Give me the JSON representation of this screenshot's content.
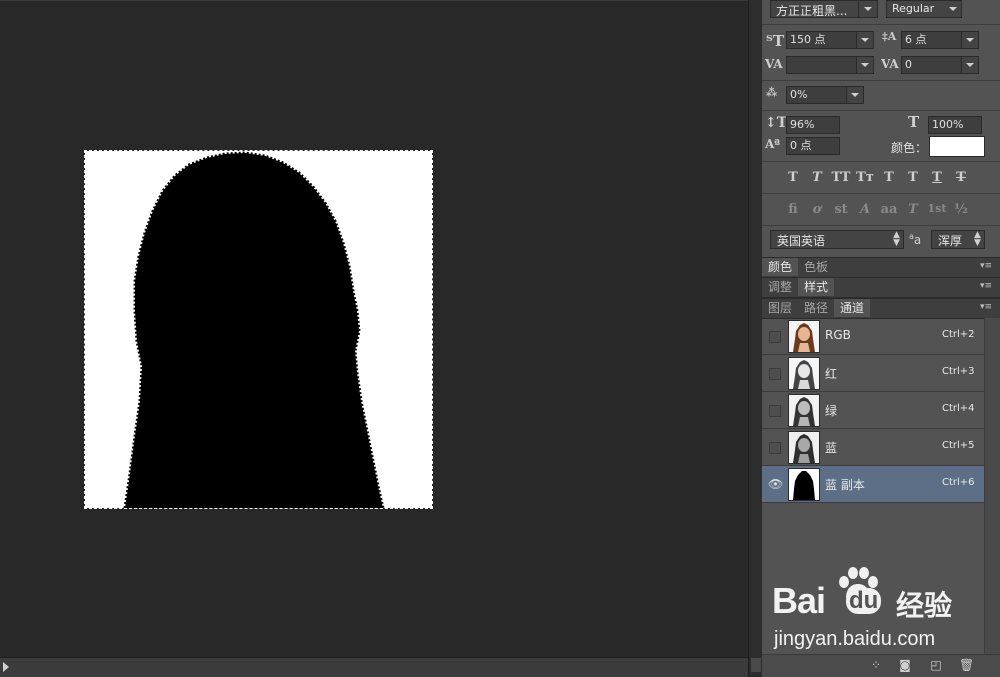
{
  "character": {
    "font_family": "方正正粗黑...",
    "font_style": "Regular",
    "font_size": "150 点",
    "leading": "6 点",
    "kerning": "",
    "tracking": "0",
    "tsume": "0%",
    "vertical_scale": "96%",
    "horizontal_scale": "100%",
    "baseline_shift": "0 点",
    "color_label": "颜色：",
    "color_value": "#ffffff",
    "language": "英国英语",
    "antialias_glyph": "a",
    "antialias": "浑厚",
    "style_buttons": [
      "T",
      "T",
      "TT",
      "Tт",
      "T",
      "T",
      "T",
      "T"
    ],
    "opentype_buttons": [
      "fi",
      "ơ",
      "st",
      "A",
      "aa",
      "T",
      "1st",
      "½"
    ]
  },
  "panels": {
    "group1": [
      "颜色",
      "色板"
    ],
    "group2": [
      "调整",
      "样式"
    ],
    "group3": [
      "图层",
      "路径",
      "通道"
    ]
  },
  "channels": [
    {
      "name": "RGB",
      "shortcut": "Ctrl+2",
      "thumb": "color",
      "visible": false,
      "selected": false
    },
    {
      "name": "红",
      "shortcut": "Ctrl+3",
      "thumb": "gray",
      "visible": false,
      "selected": false
    },
    {
      "name": "绿",
      "shortcut": "Ctrl+4",
      "thumb": "gray",
      "visible": false,
      "selected": false
    },
    {
      "name": "蓝",
      "shortcut": "Ctrl+5",
      "thumb": "gray",
      "visible": false,
      "selected": false
    },
    {
      "name": "蓝 副本",
      "shortcut": "Ctrl+6",
      "thumb": "mask",
      "visible": true,
      "selected": true
    }
  ],
  "watermark": {
    "brand": "Bai",
    "brand2": "du",
    "product": "经验",
    "url": "jingyan.baidu.com"
  },
  "colors": {
    "accent_selected": "#5d6f86",
    "panel_bg": "#535353",
    "canvas_bg": "#282828"
  }
}
